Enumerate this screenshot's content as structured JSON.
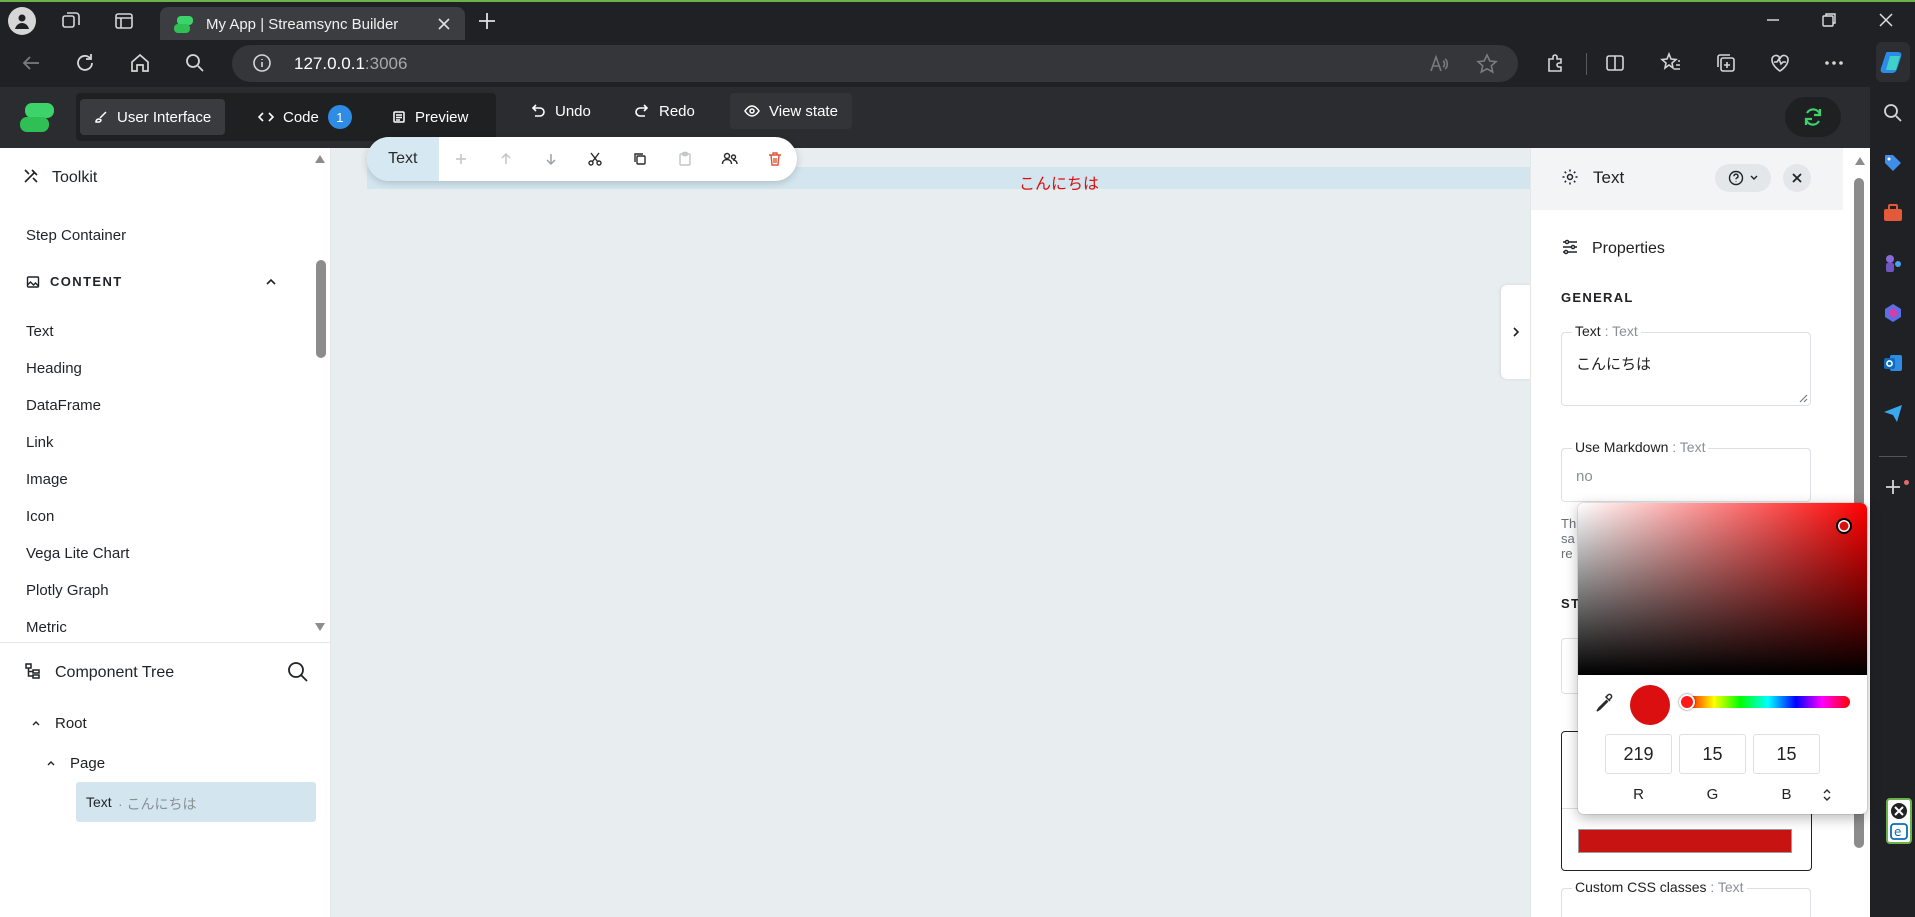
{
  "browser": {
    "tab_title": "My App | Streamsync Builder",
    "url_host": "127.0.0.1",
    "url_port": ":3006"
  },
  "header": {
    "user_interface_label": "User Interface",
    "code_label": "Code",
    "code_badge": "1",
    "preview_label": "Preview",
    "undo_label": "Undo",
    "redo_label": "Redo",
    "view_state_label": "View state"
  },
  "toolkit": {
    "title": "Toolkit",
    "step_container": "Step Container",
    "section_title": "CONTENT",
    "items": [
      "Text",
      "Heading",
      "DataFrame",
      "Link",
      "Image",
      "Icon",
      "Vega Lite Chart",
      "Plotly Graph",
      "Metric"
    ]
  },
  "tree": {
    "title": "Component Tree",
    "root": "Root",
    "page": "Page",
    "text_node_name": "Text",
    "text_node_value": " · こんにちは"
  },
  "canvas": {
    "text": "こんにちは",
    "toolbar_label": "Text"
  },
  "settings": {
    "title": "Text",
    "properties_title": "Properties",
    "general_label": "GENERAL",
    "text_field_label": "Text",
    "text_field_type": " : Text",
    "text_value": "こんにちは",
    "markdown_label": "Use Markdown",
    "markdown_type": " : Text",
    "markdown_value": "no",
    "partial_desc": [
      "Th",
      "sa",
      "re"
    ],
    "partial_section": "ST",
    "custom_css_label": "Custom CSS classes",
    "custom_css_type": " : Text"
  },
  "color_picker": {
    "r": "219",
    "g": "15",
    "b": "15",
    "r_label": "R",
    "g_label": "G",
    "b_label": "B",
    "swatch_color": "#db0f0f",
    "hue_position": 0
  },
  "colors": {
    "accent_green": "#3bd36a",
    "text_red": "#db0f0f",
    "badge_blue": "#2f8ce4"
  }
}
